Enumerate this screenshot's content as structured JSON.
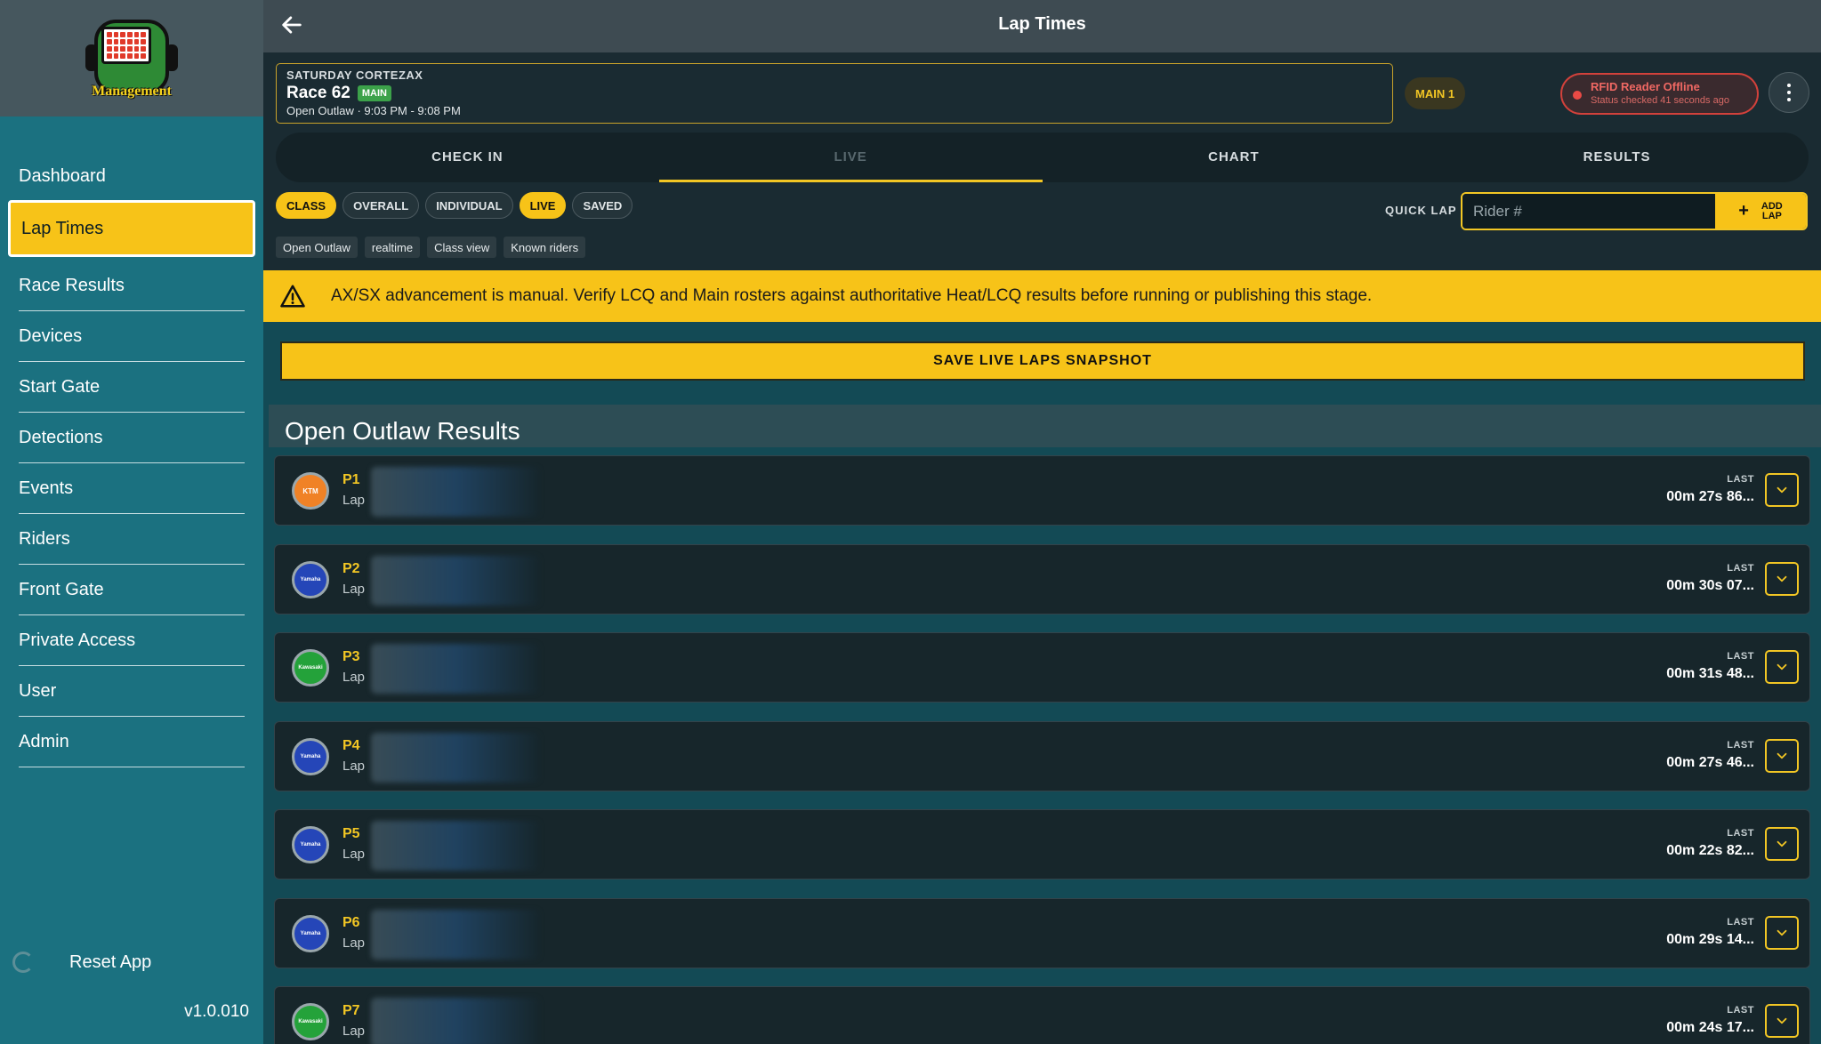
{
  "app": {
    "logo_text": "Management",
    "version": "v1.0.010",
    "reset_label": "Reset App"
  },
  "sidebar": {
    "items": [
      {
        "label": "Dashboard"
      },
      {
        "label": "Lap Times",
        "active": true
      },
      {
        "label": "Race Results"
      },
      {
        "label": "Devices"
      },
      {
        "label": "Start Gate"
      },
      {
        "label": "Detections"
      },
      {
        "label": "Events"
      },
      {
        "label": "Riders"
      },
      {
        "label": "Front Gate"
      },
      {
        "label": "Private Access"
      },
      {
        "label": "User"
      },
      {
        "label": "Admin"
      }
    ]
  },
  "topbar": {
    "title": "Lap Times"
  },
  "race": {
    "event": "SATURDAY CORTEZAX",
    "name": "Race 62",
    "badge": "MAIN",
    "subtitle": "Open Outlaw · 9:03 PM - 9:08 PM",
    "stage_chip": "MAIN 1"
  },
  "rfid": {
    "title": "RFID Reader Offline",
    "status": "Status checked 41 seconds ago",
    "color": "#d2413b"
  },
  "tabs": [
    {
      "label": "CHECK IN"
    },
    {
      "label": "LIVE",
      "active": true
    },
    {
      "label": "CHART"
    },
    {
      "label": "RESULTS"
    }
  ],
  "filters": [
    {
      "label": "CLASS",
      "active": true
    },
    {
      "label": "OVERALL"
    },
    {
      "label": "INDIVIDUAL"
    },
    {
      "label": "LIVE",
      "active": true
    },
    {
      "label": "SAVED"
    }
  ],
  "tags": [
    "Open Outlaw",
    "realtime",
    "Class view",
    "Known riders"
  ],
  "quick_lap": {
    "label": "QUICK LAP",
    "placeholder": "Rider #",
    "add_label": "ADD LAP"
  },
  "warning": {
    "text": "AX/SX advancement is manual. Verify LCQ and Main rosters against authoritative Heat/LCQ results before running or publishing this stage."
  },
  "save_button": "SAVE LIVE LAPS SNAPSHOT",
  "results": {
    "title": "Open Outlaw Results",
    "last_label": "LAST",
    "lap_label": "Lap",
    "riders": [
      {
        "pos": "P1",
        "brand": "KTM",
        "color": "#f08226",
        "last": "00m 27s 86..."
      },
      {
        "pos": "P2",
        "brand": "Yamaha",
        "color": "#2546b8",
        "last": "00m 30s 07..."
      },
      {
        "pos": "P3",
        "brand": "Kawasaki",
        "color": "#24a23a",
        "last": "00m 31s 48..."
      },
      {
        "pos": "P4",
        "brand": "Yamaha",
        "color": "#2546b8",
        "last": "00m 27s 46..."
      },
      {
        "pos": "P5",
        "brand": "Yamaha",
        "color": "#2546b8",
        "last": "00m 22s 82..."
      },
      {
        "pos": "P6",
        "brand": "Yamaha",
        "color": "#2546b8",
        "last": "00m 29s 14..."
      },
      {
        "pos": "P7",
        "brand": "Kawasaki",
        "color": "#24a23a",
        "last": "00m 24s 17..."
      }
    ]
  }
}
